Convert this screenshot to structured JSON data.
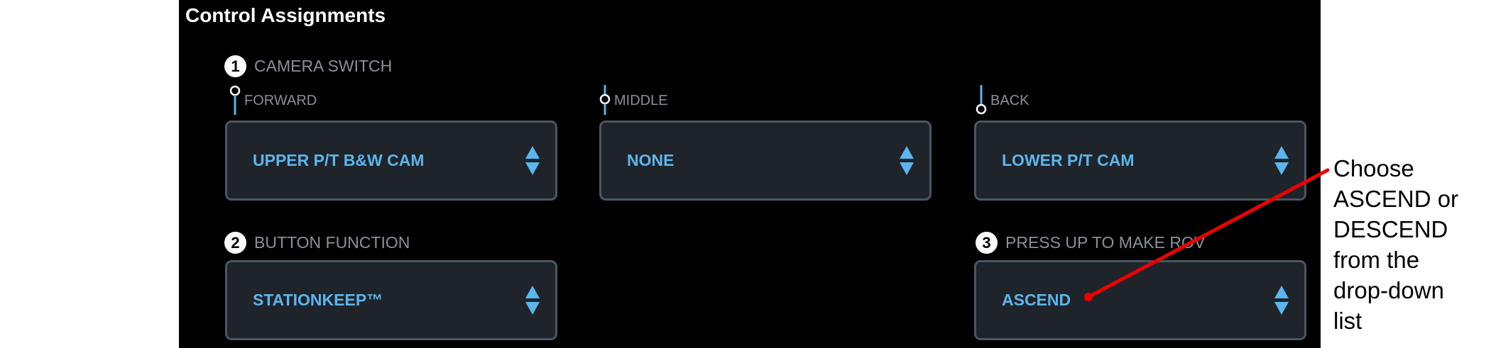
{
  "panel": {
    "title": "Control Assignments",
    "camera_switch": {
      "number": "1",
      "label": "CAMERA SWITCH",
      "positions": [
        {
          "label": "FORWARD",
          "value": "UPPER P/T B&W CAM"
        },
        {
          "label": "MIDDLE",
          "value": "NONE"
        },
        {
          "label": "BACK",
          "value": "LOWER P/T CAM"
        }
      ]
    },
    "button_function": {
      "number": "2",
      "label": "BUTTON FUNCTION",
      "value": "STATIONKEEP™"
    },
    "press_up": {
      "number": "3",
      "label": "PRESS UP TO MAKE ROV",
      "value": "ASCEND"
    }
  },
  "annotation": {
    "lines": [
      "Choose",
      "ASCEND or",
      "DESCEND",
      "from the",
      "drop-down",
      "list"
    ],
    "color": "#ee0000"
  },
  "colors": {
    "panel_bg": "#000000",
    "dropdown_bg": "#1f232a",
    "dropdown_border": "#4a5664",
    "accent": "#5ab6ec",
    "label": "#8a9099"
  }
}
